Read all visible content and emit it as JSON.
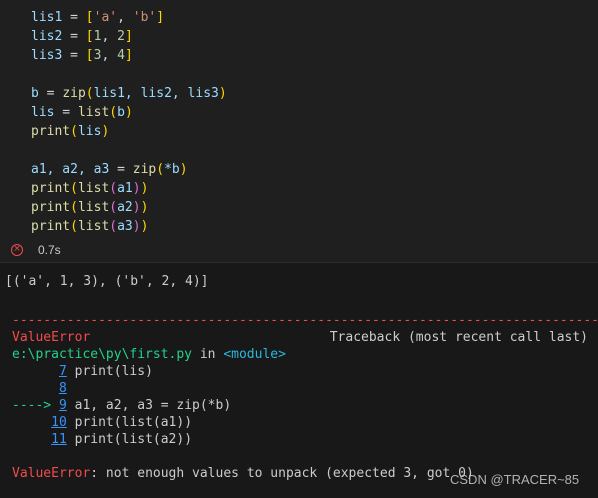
{
  "code": {
    "line1": [
      "lis1",
      " = ",
      "[",
      "'a'",
      ", ",
      "'b'",
      "]"
    ],
    "line2": [
      "lis2",
      " = ",
      "[",
      "1",
      ", ",
      "2",
      "]"
    ],
    "line3": [
      "lis3",
      " = ",
      "[",
      "3",
      ", ",
      "4",
      "]"
    ],
    "line5": [
      "b",
      " = ",
      "zip",
      "(",
      "lis1, lis2, lis3",
      ")"
    ],
    "line6": [
      "lis",
      " = ",
      "list",
      "(",
      "b",
      ")"
    ],
    "line7": [
      "print",
      "(",
      "lis",
      ")"
    ],
    "line9": [
      "a1, a2, a3",
      " = ",
      "zip",
      "(",
      "*b",
      ")"
    ],
    "line10": [
      "print",
      "(",
      "list",
      "(",
      "a1",
      ")",
      ")"
    ],
    "line11": [
      "print",
      "(",
      "list",
      "(",
      "a2",
      ")",
      ")"
    ],
    "line12": [
      "print",
      "(",
      "list",
      "(",
      "a3",
      ")",
      ")"
    ]
  },
  "status": {
    "icon": "error-circle-icon",
    "exec_time": "0.7s"
  },
  "output": {
    "result": "[('a', 1, 3), ('b', 2, 4)]",
    "separator": "---------------------------------------------------------------------------",
    "error_name": "ValueError",
    "traceback_label": "Traceback (most recent call last)",
    "file_path": "e:\\practice\\py\\first.py",
    "file_in": " in ",
    "module": "<module>",
    "tb": [
      {
        "arrow": "      ",
        "num": "7",
        "code": " print(lis)"
      },
      {
        "arrow": "      ",
        "num": "8",
        "code": ""
      },
      {
        "arrow": "----> ",
        "num": "9",
        "code": " a1, a2, a3 = zip(*b)"
      },
      {
        "arrow": "     ",
        "num": "10",
        "code": " print(list(a1))"
      },
      {
        "arrow": "     ",
        "num": "11",
        "code": " print(list(a2))"
      }
    ],
    "final_error_name": "ValueError",
    "final_error_msg": ": not enough values to unpack (expected 3, got 0)"
  },
  "watermark": "CSDN @TRACER~85",
  "colors": {
    "background": "#1f1f1f",
    "error_red": "#f14c4c",
    "arrow_green": "#23d18b",
    "module_cyan": "#29b8db",
    "link_blue": "#3794ff"
  }
}
